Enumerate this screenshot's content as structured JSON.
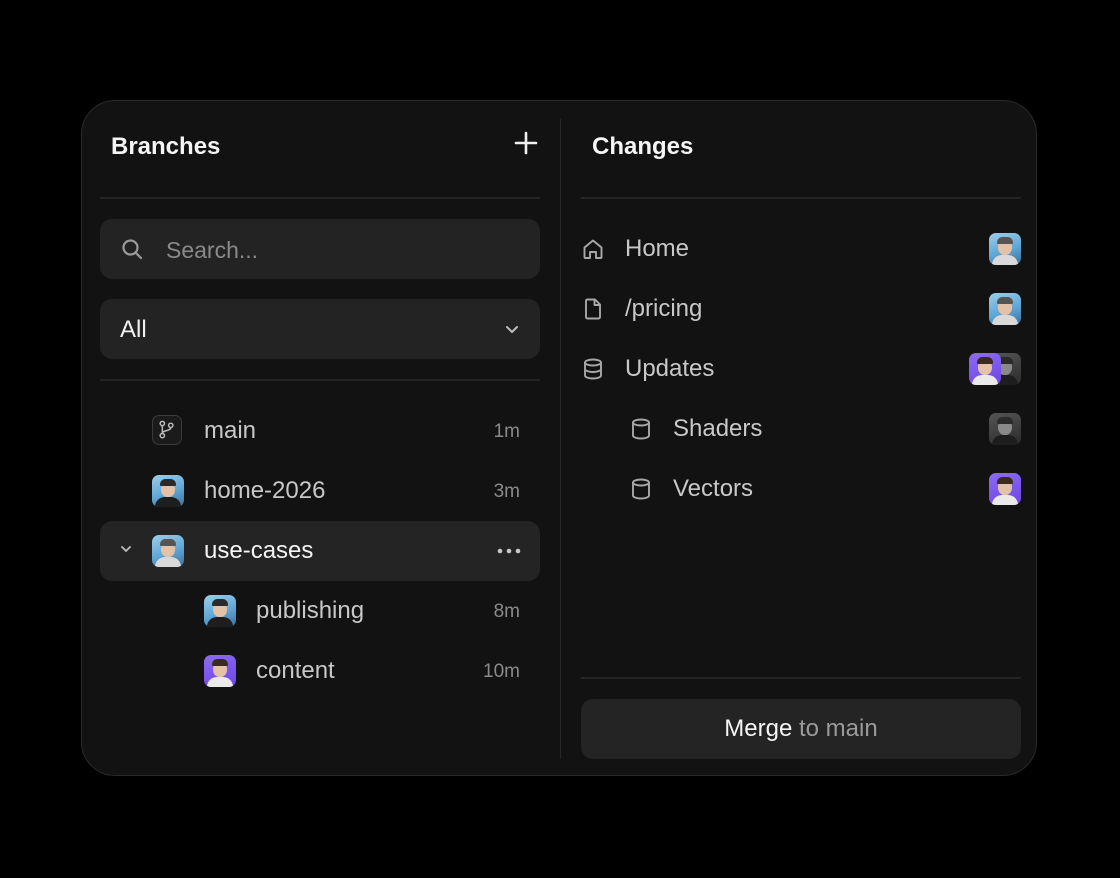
{
  "branches_panel": {
    "title": "Branches",
    "add_icon": "plus-icon",
    "search": {
      "placeholder": "Search...",
      "value": ""
    },
    "filter": {
      "selected": "All"
    },
    "items": [
      {
        "name": "main",
        "time": "1m",
        "icon": "branch-icon"
      },
      {
        "name": "home-2026",
        "time": "3m",
        "avatar": "avatar"
      },
      {
        "name": "use-cases",
        "time": "",
        "avatar": "avatar",
        "expanded": true,
        "active": true
      },
      {
        "name": "publishing",
        "time": "8m",
        "avatar": "avatar"
      },
      {
        "name": "content",
        "time": "10m",
        "avatar": "avatar"
      }
    ]
  },
  "changes_panel": {
    "title": "Changes",
    "items": [
      {
        "label": "Home",
        "icon": "home-icon"
      },
      {
        "label": "/pricing",
        "icon": "file-icon"
      },
      {
        "label": "Updates",
        "icon": "database-icon"
      },
      {
        "label": "Shaders",
        "icon": "database-icon"
      },
      {
        "label": "Vectors",
        "icon": "database-icon"
      }
    ],
    "merge": {
      "action": "Merge",
      "target": "to main"
    }
  }
}
